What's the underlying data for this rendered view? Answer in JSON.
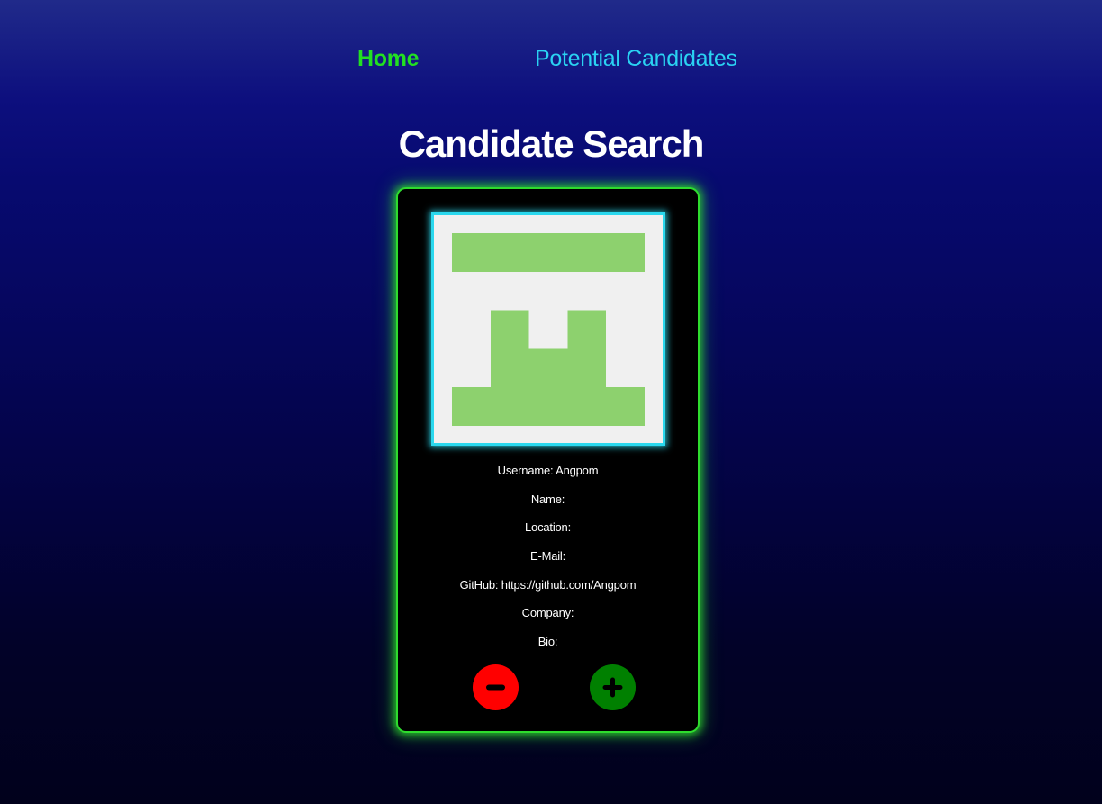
{
  "nav": {
    "home_label": "Home",
    "potential_label": "Potential Candidates",
    "home_color": "#22e022",
    "potential_color": "#2ad2f2"
  },
  "page": {
    "title": "Candidate Search"
  },
  "candidate": {
    "avatar_icon": "identicon",
    "avatar_color": "#8dd16e",
    "avatar_border_color": "#2ad8ee",
    "username": "Username: Angpom",
    "name": "Name:",
    "location": "Location:",
    "email": "E-Mail:",
    "github": "GitHub: https://github.com/Angpom",
    "company": "Company:",
    "bio": "Bio:"
  },
  "actions": {
    "reject_icon": "minus-icon",
    "accept_icon": "plus-icon",
    "reject_color": "#ff0000",
    "accept_color": "#008000"
  },
  "theme": {
    "card_glow": "#2edc2e"
  }
}
